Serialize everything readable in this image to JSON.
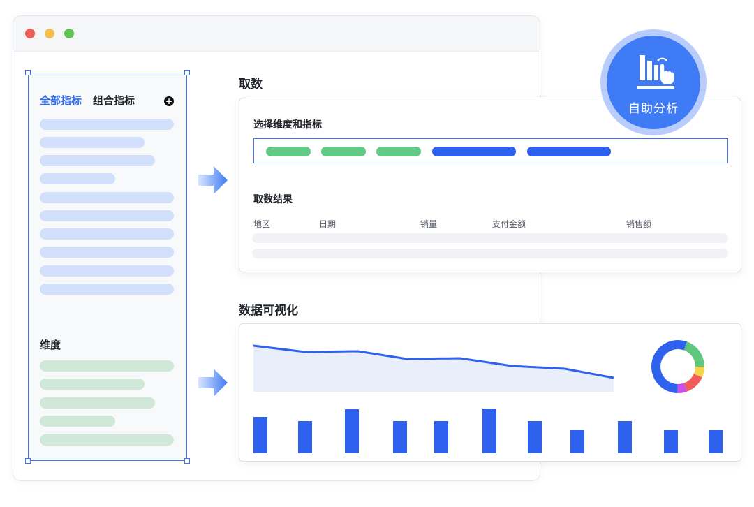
{
  "window": {
    "controls": [
      "close",
      "minimize",
      "maximize"
    ],
    "colors": {
      "close": "#ee5f57",
      "minimize": "#f5be4f",
      "maximize": "#5fc454"
    }
  },
  "sidebar": {
    "tabs": [
      {
        "label": "全部指标",
        "active": true
      },
      {
        "label": "组合指标",
        "active": false
      }
    ],
    "add_icon": "plus-circle-icon",
    "dimension_label": "维度"
  },
  "query": {
    "title": "取数",
    "selector_label": "选择维度和指标",
    "result_title": "取数结果",
    "columns": [
      "地区",
      "日期",
      "销量",
      "支付金额",
      "销售额"
    ]
  },
  "visualization": {
    "title": "数据可视化"
  },
  "badge": {
    "label": "自助分析",
    "icon": "self-service-analysis-icon"
  },
  "colors": {
    "accent": "#3b74f0",
    "bar": "#2e62ee",
    "metric_tag": "#2e62ee",
    "dimension_tag": "#62c987"
  }
}
